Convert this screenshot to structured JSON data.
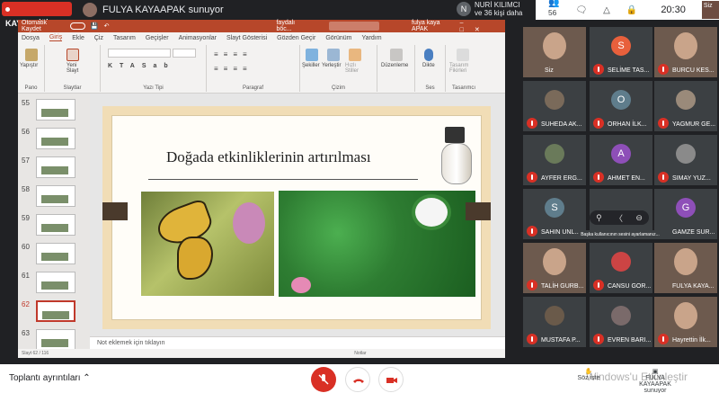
{
  "meet": {
    "recording_label": "KAYDEDİLİYOR",
    "presenter": "FULYA KAYAAPAK sunuyor",
    "notification_avatar": "N",
    "notification_line1": "NURİ KILIMCI",
    "notification_line2": "ve 36 kişi daha",
    "participant_count": "56",
    "time": "20:30",
    "self_label": "Siz"
  },
  "ppt": {
    "autosave_label": "Otomatik Kaydet",
    "file_name": "faydalı böc...",
    "user_name": "fulya kaya APAK",
    "menu": [
      "Dosya",
      "Giriş",
      "Ekle",
      "Çiz",
      "Tasarım",
      "Geçişler",
      "Animasyonlar",
      "Slayt Gösterisi",
      "Gözden Geçir",
      "Görünüm",
      "Yardım"
    ],
    "active_menu": "Giriş",
    "groups": {
      "pano": "Pano",
      "slaytlar": "Slaytlar",
      "yazi_tipi": "Yazı Tipi",
      "paragraf": "Paragraf",
      "cizim": "Çizim",
      "ses": "Ses",
      "tasarimci": "Tasarımcı"
    },
    "buttons": {
      "yapistir": "Yapıştır",
      "yeni_slayt": "Yeni Slayt",
      "sekiller": "Şekiller",
      "yerlestir": "Yerleştir",
      "hizli_stiller": "Hızlı Stiller",
      "duzenleme": "Düzenleme",
      "dikte": "Dikte",
      "tasarim_fikirleri": "Tasarım Fikirleri"
    },
    "thumbnails": [
      "55",
      "56",
      "57",
      "58",
      "59",
      "60",
      "61",
      "62",
      "63"
    ],
    "selected_thumbnail": "62",
    "slide_title": "Doğada etkinliklerinin artırılması",
    "notes_placeholder": "Not eklemek için tıklayın",
    "status": "Slayt 62 / 116",
    "notes_button": "Notlar"
  },
  "participants": [
    {
      "name": "Siz",
      "type": "video"
    },
    {
      "name": "SELİME TAS...",
      "initial": "S",
      "color": "#e8603c"
    },
    {
      "name": "BURCU KES...",
      "type": "video"
    },
    {
      "name": "SUHEDA AK...",
      "type": "video"
    },
    {
      "name": "ORHAN İLK...",
      "initial": "O",
      "color": "#5f7d8c"
    },
    {
      "name": "YAGMUR GE...",
      "type": "video"
    },
    {
      "name": "AYFER ERG...",
      "type": "video"
    },
    {
      "name": "AHMET EN...",
      "initial": "A",
      "color": "#8e4fb8"
    },
    {
      "name": "SIMAY YUZ...",
      "type": "video"
    },
    {
      "name": "SAHIN UNL...",
      "initial": "S",
      "color": "#5f7d8c"
    },
    {
      "name": "GAMZE SUR...",
      "initial": "G",
      "color": "#8e4fb8"
    },
    {
      "name": "TALİH GURB...",
      "type": "video"
    },
    {
      "name": "CANSU GOR...",
      "type": "video"
    },
    {
      "name": "FULYA KAYA...",
      "type": "video"
    },
    {
      "name": "MUSTAFA P...",
      "type": "video"
    },
    {
      "name": "EVREN BARI...",
      "type": "video"
    },
    {
      "name": "Hayrettin İlk...",
      "type": "video"
    }
  ],
  "tooltip": "Başka kullanıcının sesini ayarlamanız...",
  "bottom": {
    "details": "Toplantı ayrıntıları",
    "raise_hand": "Söz iste",
    "present": "FULYA KAYAAPAK sunuyor",
    "watermark": "Windows'u Etkinleştir"
  }
}
